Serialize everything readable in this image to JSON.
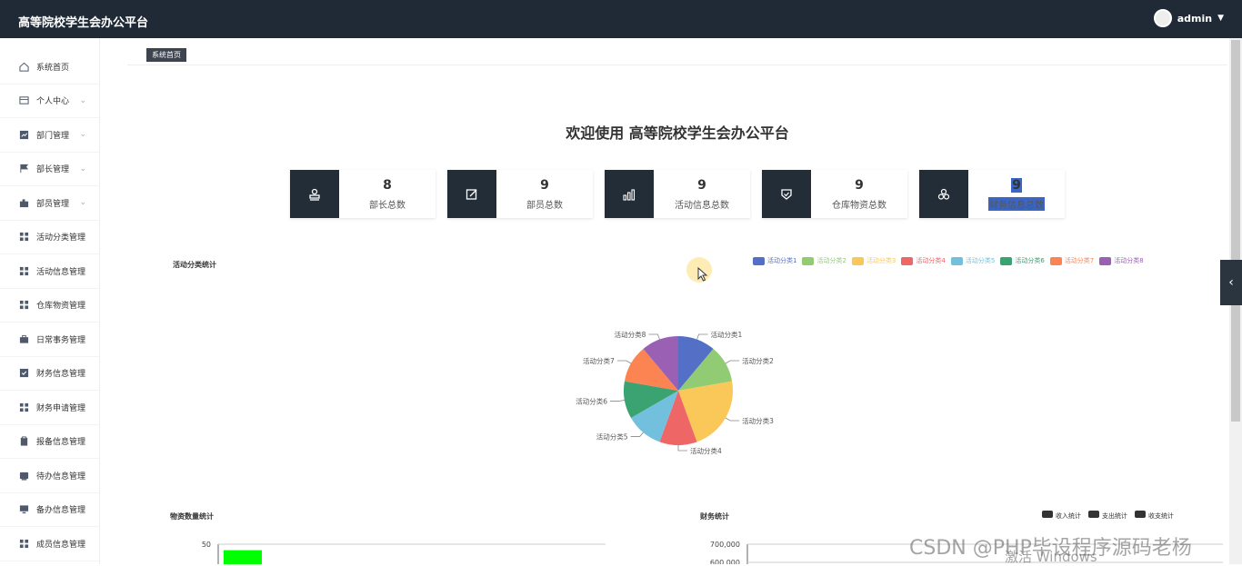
{
  "header": {
    "title": "高等院校学生会办公平台",
    "user": "admin"
  },
  "sidebar": {
    "items": [
      {
        "label": "系统首页",
        "icon": "home-icon",
        "expand": false
      },
      {
        "label": "个人中心",
        "icon": "id-card-icon",
        "expand": true
      },
      {
        "label": "部门管理",
        "icon": "chart-icon",
        "expand": true
      },
      {
        "label": "部长管理",
        "icon": "flag-icon",
        "expand": true
      },
      {
        "label": "部员管理",
        "icon": "puzzle-icon",
        "expand": true
      },
      {
        "label": "活动分类管理",
        "icon": "grid-icon",
        "expand": false
      },
      {
        "label": "活动信息管理",
        "icon": "grid-icon",
        "expand": false
      },
      {
        "label": "仓库物资管理",
        "icon": "grid-icon",
        "expand": false
      },
      {
        "label": "日常事务管理",
        "icon": "briefcase-icon",
        "expand": false
      },
      {
        "label": "财务信息管理",
        "icon": "check-box-icon",
        "expand": false
      },
      {
        "label": "财务申请管理",
        "icon": "grid-icon",
        "expand": false
      },
      {
        "label": "报备信息管理",
        "icon": "clipboard-icon",
        "expand": false
      },
      {
        "label": "待办信息管理",
        "icon": "inbox-icon",
        "expand": false
      },
      {
        "label": "备办信息管理",
        "icon": "monitor-icon",
        "expand": false
      },
      {
        "label": "成员信息管理",
        "icon": "grid-icon",
        "expand": false
      }
    ]
  },
  "tabs": {
    "active": "系统首页"
  },
  "main": {
    "welcome": "欢迎使用 高等院校学生会办公平台",
    "cards": [
      {
        "value": "8",
        "label": "部长总数",
        "icon": "stamp-icon"
      },
      {
        "value": "9",
        "label": "部员总数",
        "icon": "edit-icon"
      },
      {
        "value": "9",
        "label": "活动信息总数",
        "icon": "bar-chart-icon"
      },
      {
        "value": "9",
        "label": "仓库物资总数",
        "icon": "shield-icon"
      },
      {
        "value": "9",
        "label": "财务信息总数",
        "icon": "cluster-icon"
      }
    ],
    "pie_title": "活动分类统计",
    "material_title": "物资数量统计",
    "finance_title": "财务统计",
    "finance_legend": [
      "收入统计",
      "支出统计",
      "收支统计"
    ]
  },
  "chart_data": [
    {
      "type": "pie",
      "title": "活动分类统计",
      "categories": [
        "活动分类1",
        "活动分类2",
        "活动分类3",
        "活动分类4",
        "活动分类5",
        "活动分类6",
        "活动分类7",
        "活动分类8"
      ],
      "values": [
        1,
        1,
        2,
        1,
        1,
        1,
        1,
        1
      ],
      "colors": [
        "#5470c6",
        "#91cc75",
        "#fac858",
        "#ee6666",
        "#73c0de",
        "#3ba272",
        "#fc8452",
        "#9a60b4"
      ],
      "legend": "top-right"
    },
    {
      "type": "bar",
      "title": "物资数量统计",
      "y_tick_labels": [
        "50"
      ],
      "values": [
        47
      ],
      "bar_color": "#00ff00"
    },
    {
      "type": "bar",
      "title": "财务统计",
      "y_tick_labels": [
        "700,000",
        "600,000"
      ],
      "legend": "top-right"
    }
  ],
  "watermark": {
    "line1": "CSDN @PHP毕设程序源码老杨",
    "line2": "激活 Windows"
  }
}
